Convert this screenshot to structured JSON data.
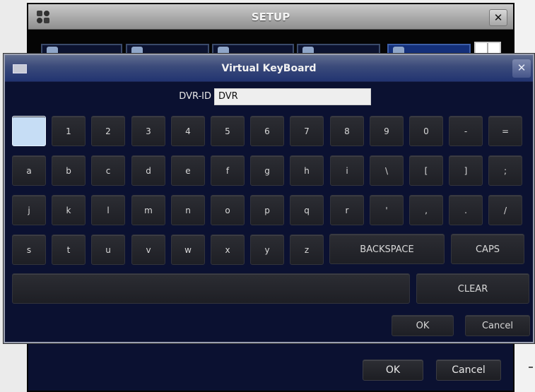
{
  "setup_window": {
    "title": "SETUP",
    "close_label": "✕",
    "ok_label": "OK",
    "cancel_label": "Cancel"
  },
  "keyboard_dialog": {
    "title": "Virtual KeyBoard",
    "close_label": "✕",
    "id_label": "DVR-ID",
    "id_value": "DVR",
    "rows": [
      [
        "",
        "1",
        "2",
        "3",
        "4",
        "5",
        "6",
        "7",
        "8",
        "9",
        "0",
        "-",
        "="
      ],
      [
        "a",
        "b",
        "c",
        "d",
        "e",
        "f",
        "g",
        "h",
        "i",
        "\\",
        "[",
        "]",
        ";"
      ],
      [
        "j",
        "k",
        "l",
        "m",
        "n",
        "o",
        "p",
        "q",
        "r",
        "'",
        ",",
        ".",
        "/"
      ],
      [
        "s",
        "t",
        "u",
        "v",
        "w",
        "x",
        "y",
        "z"
      ]
    ],
    "backspace_label": "BACKSPACE",
    "caps_label": "CAPS",
    "space_label": "",
    "clear_label": "CLEAR",
    "ok_label": "OK",
    "cancel_label": "Cancel"
  }
}
